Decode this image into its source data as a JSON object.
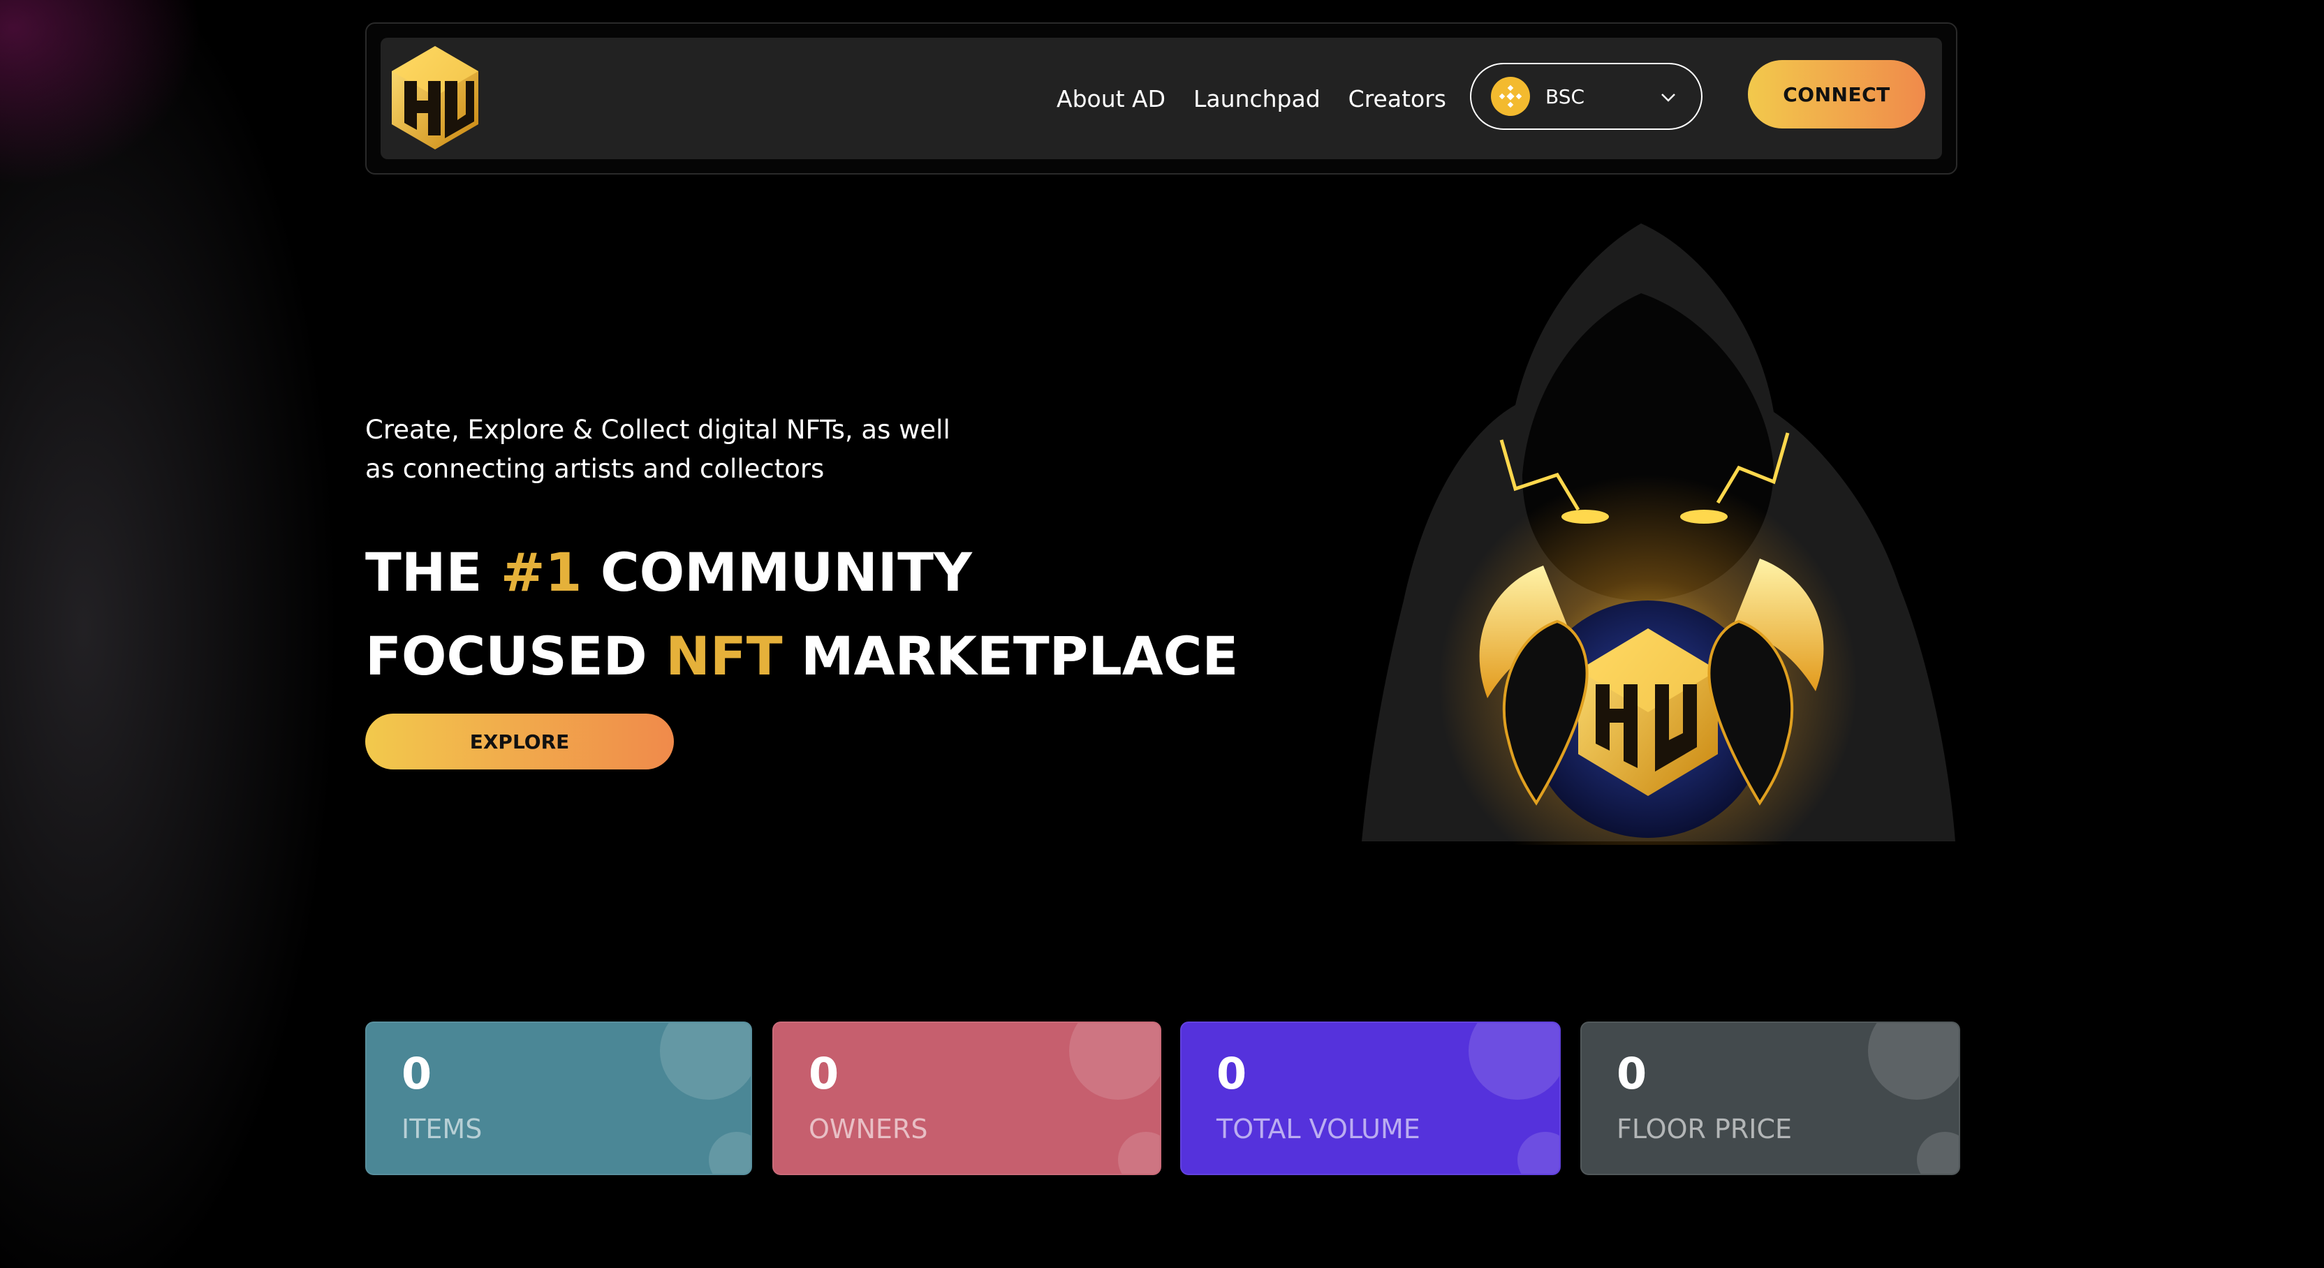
{
  "nav": {
    "links": [
      "About AD",
      "Launchpad",
      "Creators"
    ],
    "chain": {
      "label": "BSC",
      "icon": "bnb-icon"
    },
    "connect_label": "CONNECT"
  },
  "hero": {
    "tagline_line1": "Create, Explore & Collect digital NFTs, as well",
    "tagline_line2": "as connecting artists and collectors",
    "headline": {
      "part1": "THE ",
      "accent1": "#1",
      "part2": " COMMUNITY",
      "part3": "FOCUSED ",
      "accent2": "NFT",
      "part4": " MARKETPLACE"
    },
    "explore_label": "EXPLORE"
  },
  "stats": [
    {
      "value": "0",
      "label": "ITEMS",
      "color": "#4b8796"
    },
    {
      "value": "0",
      "label": "OWNERS",
      "color": "#c65f6e"
    },
    {
      "value": "0",
      "label": "TOTAL VOLUME",
      "color": "#5532dc"
    },
    {
      "value": "0",
      "label": "FLOOR PRICE",
      "color": "#434a4d"
    }
  ],
  "colors": {
    "accent": "#e5b13a",
    "button_gradient_start": "#f2c94c",
    "button_gradient_end": "#f08a4b",
    "background": "#000000",
    "nav_background": "#222222"
  }
}
